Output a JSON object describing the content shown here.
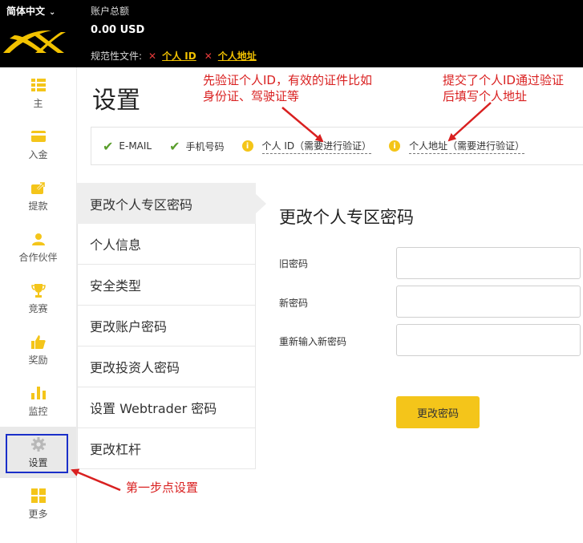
{
  "header": {
    "language": "简体中文",
    "account_total_label": "账户总额",
    "account_total_value": "0.00 USD",
    "compliance_label": "规范性文件:",
    "compliance_links": [
      "个人 ID",
      "个人地址"
    ]
  },
  "sidebar": {
    "items": [
      {
        "label": "主",
        "icon": "home-list-icon"
      },
      {
        "label": "入金",
        "icon": "card-icon"
      },
      {
        "label": "提款",
        "icon": "withdraw-icon"
      },
      {
        "label": "合作伙伴",
        "icon": "user-icon"
      },
      {
        "label": "竞赛",
        "icon": "trophy-icon"
      },
      {
        "label": "奖励",
        "icon": "thumbs-up-icon"
      },
      {
        "label": "监控",
        "icon": "bar-chart-icon"
      },
      {
        "label": "设置",
        "icon": "gear-icon"
      },
      {
        "label": "更多",
        "icon": "grid-icon"
      }
    ],
    "active_index": 7
  },
  "page": {
    "title": "设置"
  },
  "verification": [
    {
      "label": "E-MAIL",
      "status": "verified"
    },
    {
      "label": "手机号码",
      "status": "verified"
    },
    {
      "label": "个人 ID（需要进行验证）",
      "status": "pending"
    },
    {
      "label": "个人地址（需要进行验证）",
      "status": "pending"
    }
  ],
  "settings_menu": [
    "更改个人专区密码",
    "个人信息",
    "安全类型",
    "更改账户密码",
    "更改投资人密码",
    "设置 Webtrader 密码",
    "更改杠杆"
  ],
  "form": {
    "title": "更改个人专区密码",
    "old_password_label": "旧密码",
    "new_password_label": "新密码",
    "confirm_password_label": "重新输入新密码",
    "submit_label": "更改密码"
  },
  "annotations": {
    "verify_id": "先验证个人ID，有效的证件比如\n身份证、驾驶证等",
    "verify_address": "提交了个人ID通过验证\n后填写个人地址",
    "step_one": "第一步点设置"
  },
  "colors": {
    "accent": "#f4c51a",
    "annotation": "#d92020",
    "verified": "#5a9e2c",
    "highlight_box": "#1a2fc9"
  }
}
